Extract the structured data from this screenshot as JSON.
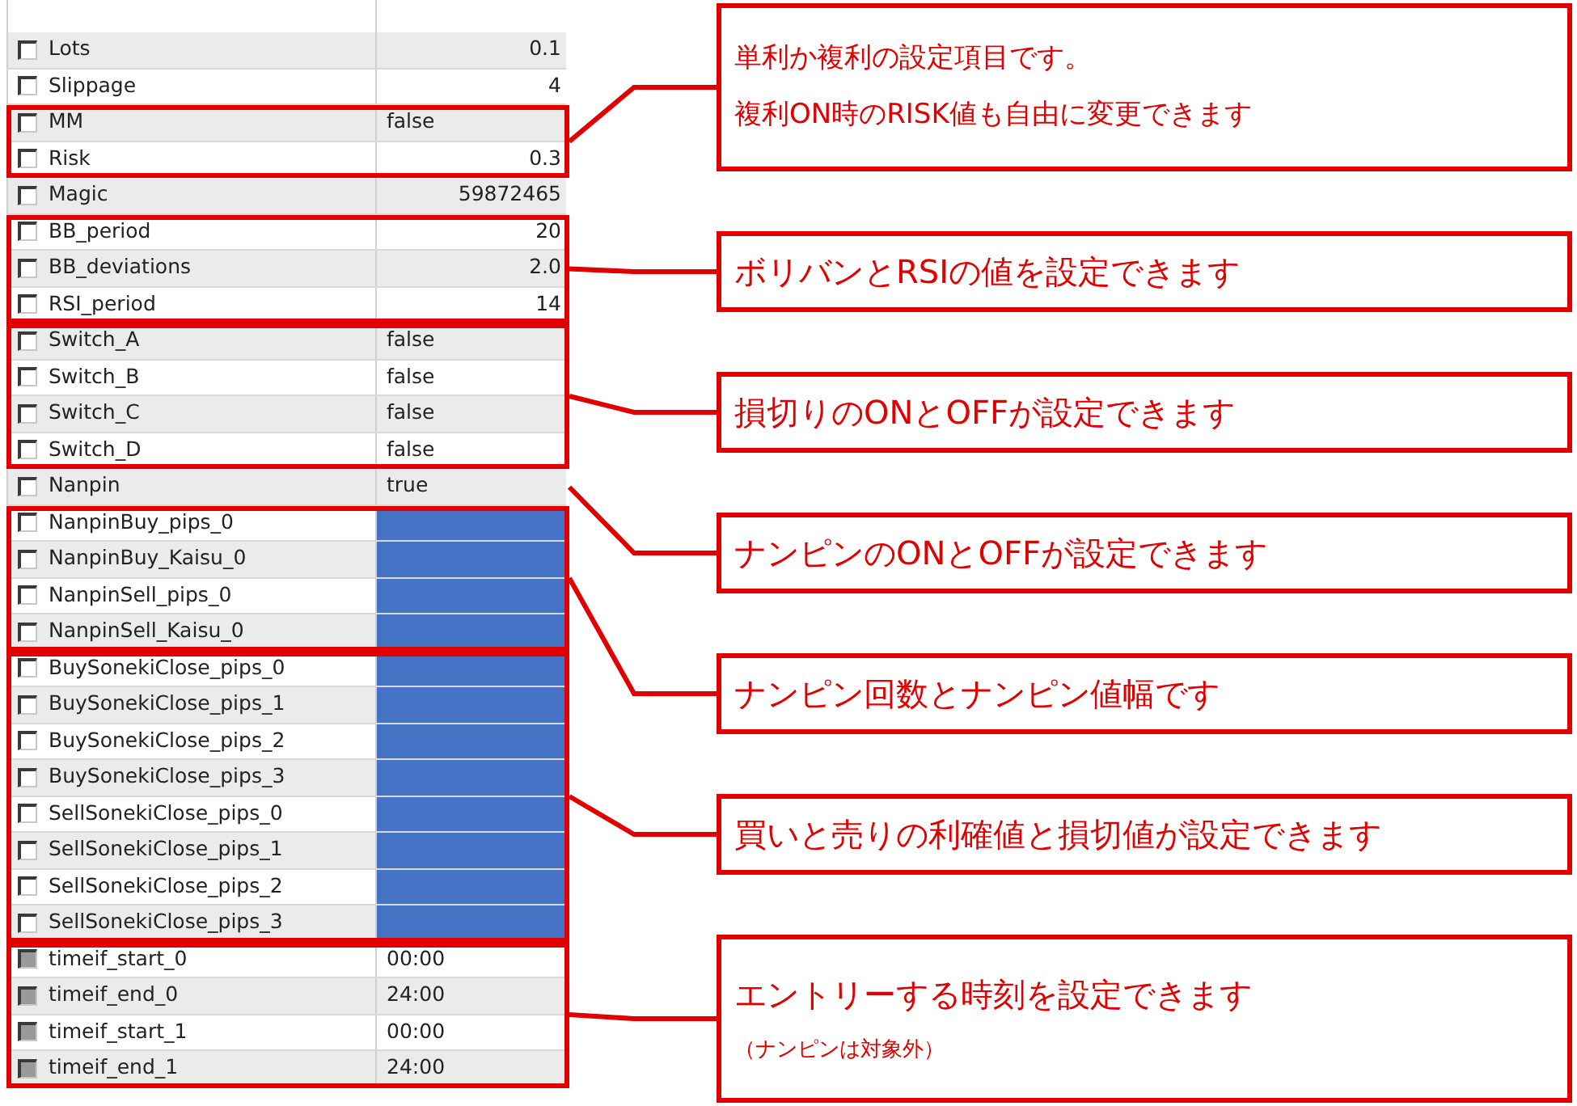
{
  "groups": [
    {
      "framed": false,
      "rows": [
        {
          "name": "Lots",
          "value": "0.1",
          "kind": "number",
          "disabled": false,
          "masked": false
        },
        {
          "name": "Slippage",
          "value": "4",
          "kind": "number",
          "disabled": false,
          "masked": false
        }
      ]
    },
    {
      "framed": true,
      "note": {
        "lines": [
          "単利か複利の設定項目です。",
          "複利ON時のRISK値も自由に変更できます"
        ]
      },
      "rows": [
        {
          "name": "MM",
          "value": "false",
          "kind": "text",
          "disabled": false,
          "masked": false
        },
        {
          "name": "Risk",
          "value": "0.3",
          "kind": "number",
          "disabled": false,
          "masked": false
        }
      ]
    },
    {
      "framed": false,
      "rows": [
        {
          "name": "Magic",
          "value": "59872465",
          "kind": "number",
          "disabled": false,
          "masked": false
        }
      ]
    },
    {
      "framed": true,
      "note": {
        "lines": [
          "ボリバンとRSIの値を設定できます"
        ]
      },
      "rows": [
        {
          "name": "BB_period",
          "value": "20",
          "kind": "number",
          "disabled": false,
          "masked": false
        },
        {
          "name": "BB_deviations",
          "value": "2.0",
          "kind": "number",
          "disabled": false,
          "masked": false
        },
        {
          "name": "RSI_period",
          "value": "14",
          "kind": "number",
          "disabled": false,
          "masked": false
        }
      ]
    },
    {
      "framed": true,
      "note": {
        "lines": [
          "損切りのONとOFFが設定できます"
        ]
      },
      "rows": [
        {
          "name": "Switch_A",
          "value": "false",
          "kind": "text",
          "disabled": false,
          "masked": false
        },
        {
          "name": "Switch_B",
          "value": "false",
          "kind": "text",
          "disabled": false,
          "masked": false
        },
        {
          "name": "Switch_C",
          "value": "false",
          "kind": "text",
          "disabled": false,
          "masked": false
        },
        {
          "name": "Switch_D",
          "value": "false",
          "kind": "text",
          "disabled": false,
          "masked": false
        }
      ]
    },
    {
      "framed": false,
      "note": {
        "lines": [
          "ナンピンのONとOFFが設定できます"
        ]
      },
      "rows": [
        {
          "name": "Nanpin",
          "value": "true",
          "kind": "text",
          "disabled": false,
          "masked": false
        }
      ]
    },
    {
      "framed": true,
      "note": {
        "lines": [
          "ナンピン回数とナンピン値幅です"
        ]
      },
      "rows": [
        {
          "name": "NanpinBuy_pips_0",
          "disabled": false,
          "masked": true
        },
        {
          "name": "NanpinBuy_Kaisu_0",
          "disabled": false,
          "masked": true
        },
        {
          "name": "NanpinSell_pips_0",
          "disabled": false,
          "masked": true
        },
        {
          "name": "NanpinSell_Kaisu_0",
          "disabled": false,
          "masked": true
        }
      ]
    },
    {
      "framed": true,
      "note": {
        "lines": [
          "買いと売りの利確値と損切値が設定できます"
        ]
      },
      "rows": [
        {
          "name": "BuySonekiClose_pips_0",
          "disabled": false,
          "masked": true
        },
        {
          "name": "BuySonekiClose_pips_1",
          "disabled": false,
          "masked": true
        },
        {
          "name": "BuySonekiClose_pips_2",
          "disabled": false,
          "masked": true
        },
        {
          "name": "BuySonekiClose_pips_3",
          "disabled": false,
          "masked": true
        },
        {
          "name": "SellSonekiClose_pips_0",
          "disabled": false,
          "masked": true
        },
        {
          "name": "SellSonekiClose_pips_1",
          "disabled": false,
          "masked": true
        },
        {
          "name": "SellSonekiClose_pips_2",
          "disabled": false,
          "masked": true
        },
        {
          "name": "SellSonekiClose_pips_3",
          "disabled": false,
          "masked": true
        }
      ]
    },
    {
      "framed": true,
      "note": {
        "lines": [
          "エントリーする時刻を設定できます"
        ],
        "subnote": "（ナンピンは対象外）"
      },
      "rows": [
        {
          "name": "timeif_start_0",
          "value": "00:00",
          "kind": "text",
          "disabled": true,
          "masked": false
        },
        {
          "name": "timeif_end_0",
          "value": "24:00",
          "kind": "text",
          "disabled": true,
          "masked": false
        },
        {
          "name": "timeif_start_1",
          "value": "00:00",
          "kind": "text",
          "disabled": true,
          "masked": false
        },
        {
          "name": "timeif_end_1",
          "value": "24:00",
          "kind": "text",
          "disabled": true,
          "masked": false
        }
      ]
    }
  ]
}
